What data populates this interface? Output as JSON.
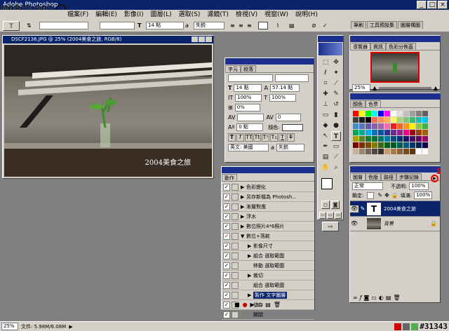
{
  "app": {
    "title": "Adobe Photoshop",
    "watermark": "MOBILE01",
    "post_number": "#31343"
  },
  "menu": [
    "檔案(F)",
    "編輯(E)",
    "影像(I)",
    "圖層(L)",
    "選取(S)",
    "濾鏡(T)",
    "檢視(V)",
    "視窗(W)",
    "說明(H)"
  ],
  "options": {
    "font_size": "14 點",
    "antialias": "失鋭",
    "aa_label": "a"
  },
  "palette_well": {
    "tabs": [
      "筆刷",
      "工具預設集",
      "圖層構圖"
    ]
  },
  "document": {
    "title": "DSCF2136.JPG @ 25% (2004美食之旅, RGB/8)",
    "caption": "2004美食之旅"
  },
  "character": {
    "tabs": [
      "字元",
      "段落"
    ],
    "size": "14 點",
    "leading": "57.14 點",
    "vscale": "100%",
    "hscale": "100%",
    "baseline": "0 點",
    "tracking": "0%",
    "kerning": "0",
    "color_label": "顏色:",
    "language": "英文: 美國",
    "aa": "失鋭"
  },
  "navigator": {
    "tabs": [
      "導覽器",
      "資訊",
      "色彩分佈直"
    ],
    "zoom": "25%"
  },
  "swatches": {
    "tabs": [
      "顏色",
      "色票"
    ]
  },
  "actions": {
    "tabs": [
      "動作"
    ],
    "items": [
      "色彩變化",
      "另存新檔為 Photosh...",
      "漸層對應",
      "浮水",
      "數位照片4*6照片",
      "數位+落款",
      "影像尺寸",
      "組合 選取範圍",
      "移動 選取範圍",
      "裁切",
      "組合 選取範圍",
      "製作 文字圖層",
      "儲存",
      "關閉"
    ]
  },
  "layers": {
    "tabs": [
      "圖層",
      "色版",
      "路徑",
      "步驟記錄"
    ],
    "blend": "正常",
    "opacity_label": "不透明:",
    "opacity": "100%",
    "lock_label": "鎖定:",
    "fill_label": "填滿:",
    "fill": "100%",
    "layers": [
      "2004美食之旅",
      "背景"
    ],
    "annotation": "1"
  },
  "status": {
    "zoom": "25%",
    "doc": "文件: 5.98M/6.08M"
  }
}
